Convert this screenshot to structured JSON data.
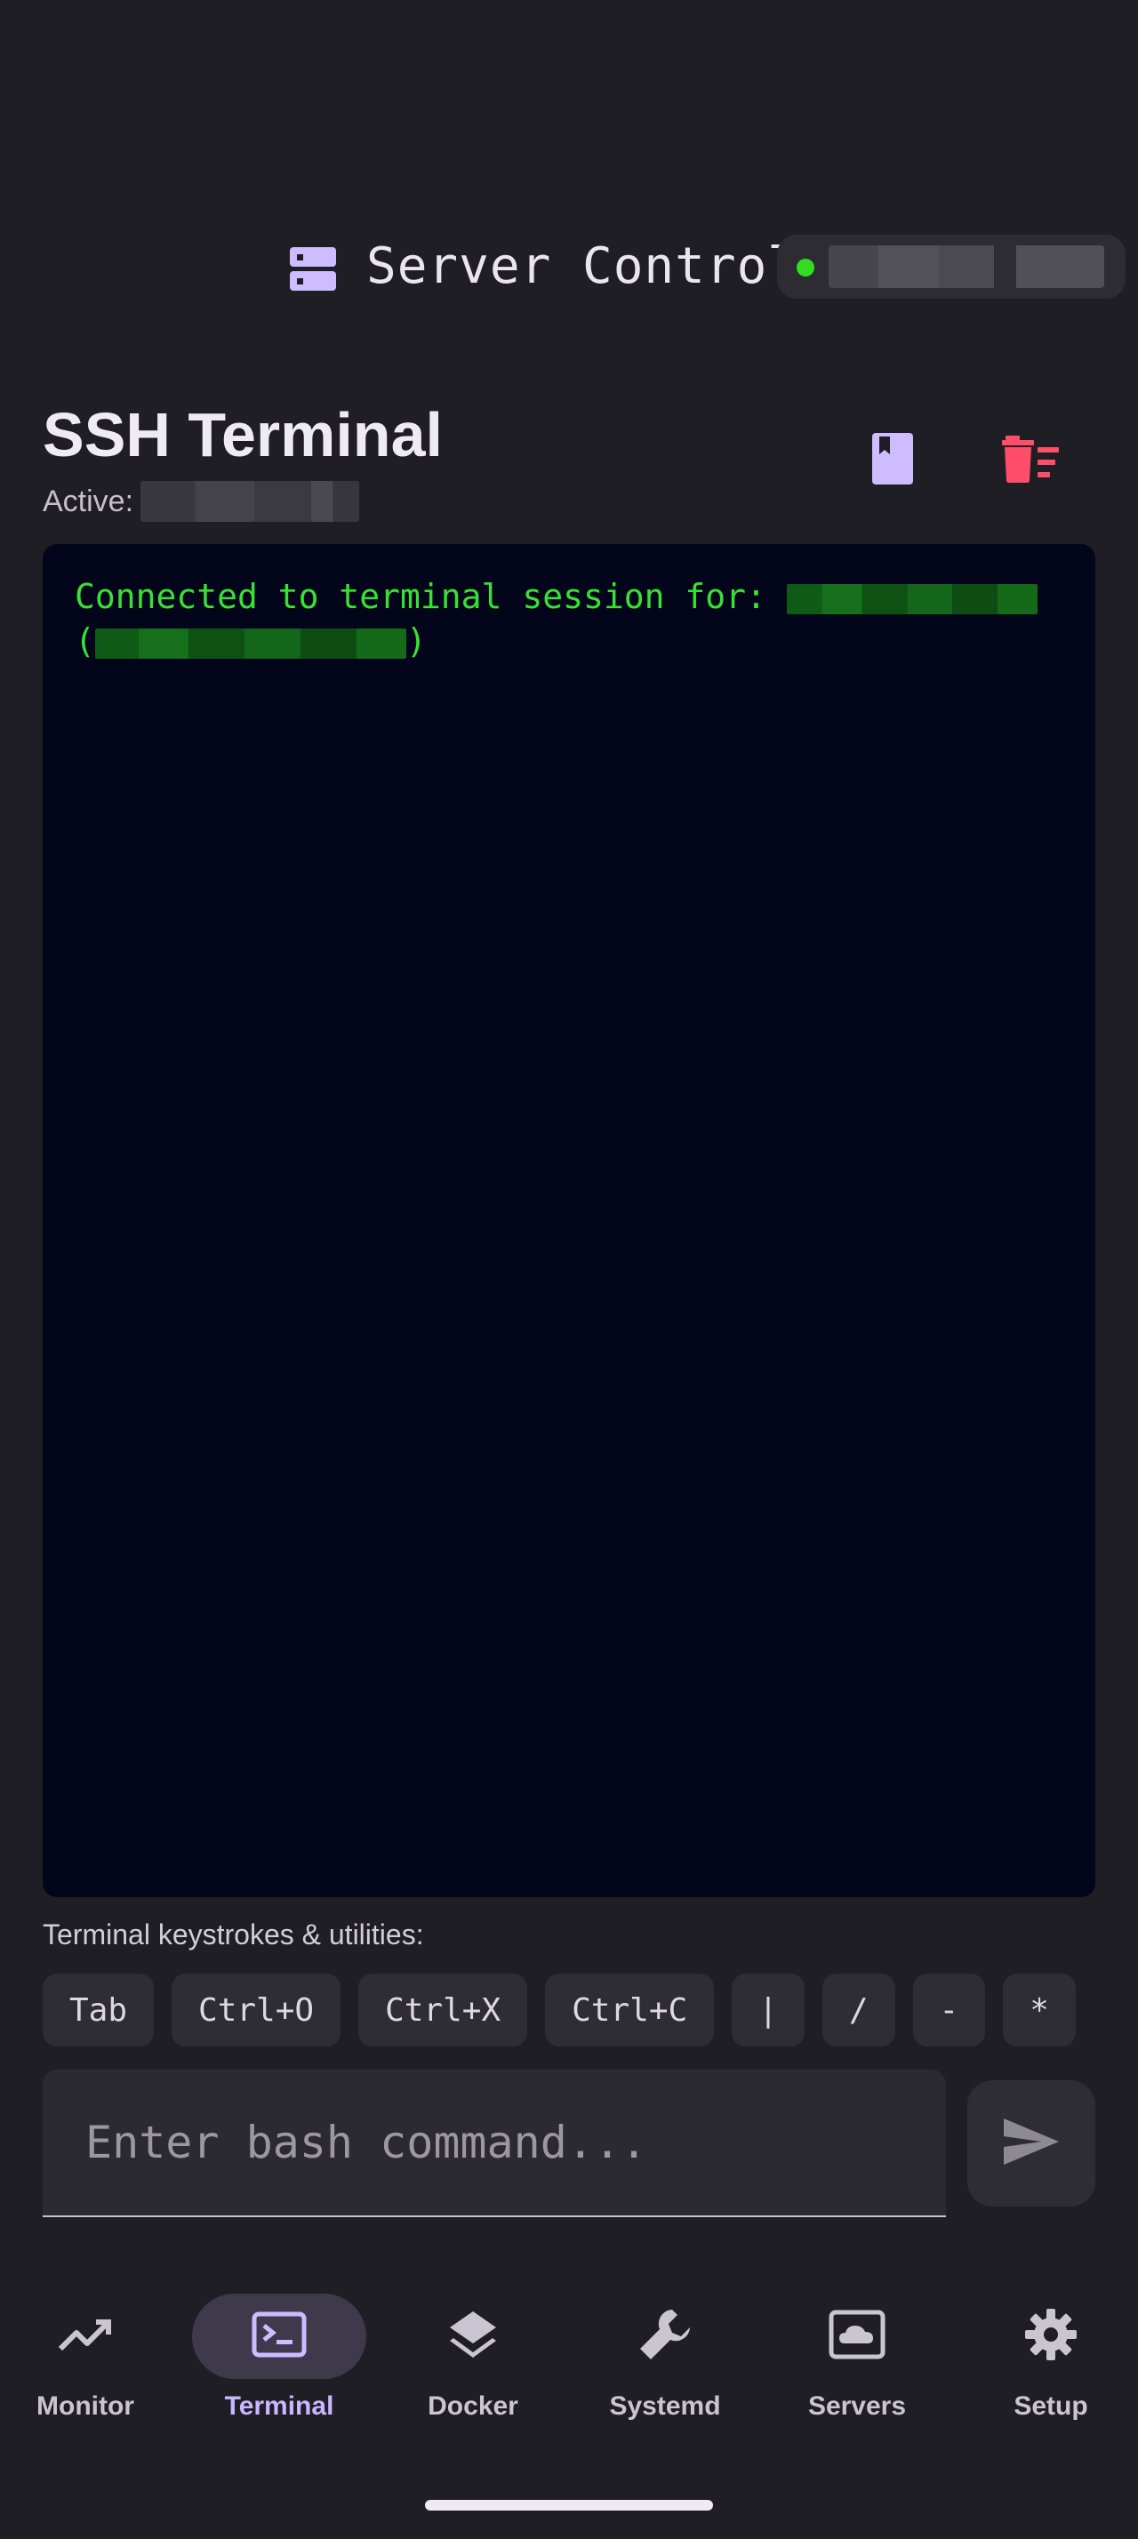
{
  "header": {
    "app_title": "Server Control",
    "server_icon": "server-icon",
    "connection": {
      "host": "redacted-host",
      "status_color": "#33dd22"
    }
  },
  "session": {
    "title": "SSH Terminal",
    "active_label": "Active:",
    "active_host": "redacted-host",
    "bookmark_icon": "bookmark-icon",
    "delete_icon": "delete-sweep-icon"
  },
  "terminal": {
    "connected_prefix": "Connected to terminal session for: ",
    "server_name": "redacted-server",
    "server_address": "redacted-address"
  },
  "utilities": {
    "label": "Terminal keystrokes & utilities:",
    "keys": [
      "Tab",
      "Ctrl+O",
      "Ctrl+X",
      "Ctrl+C",
      "|",
      "/",
      "-",
      "*"
    ]
  },
  "command": {
    "placeholder": "Enter bash command...",
    "send_icon": "send-icon"
  },
  "nav": {
    "items": [
      {
        "label": "Monitor",
        "icon": "trending-up-icon",
        "active": false
      },
      {
        "label": "Terminal",
        "icon": "terminal-icon",
        "active": true
      },
      {
        "label": "Docker",
        "icon": "layers-icon",
        "active": false
      },
      {
        "label": "Systemd",
        "icon": "wrench-icon",
        "active": false
      },
      {
        "label": "Servers",
        "icon": "cloud-box-icon",
        "active": false
      },
      {
        "label": "Setup",
        "icon": "gear-icon",
        "active": false
      }
    ]
  },
  "colors": {
    "background": "#1f1e24",
    "terminal_bg": "#03061a",
    "terminal_text": "#39e035",
    "accent": "#c9b6ff",
    "danger": "#ff4d6a"
  }
}
